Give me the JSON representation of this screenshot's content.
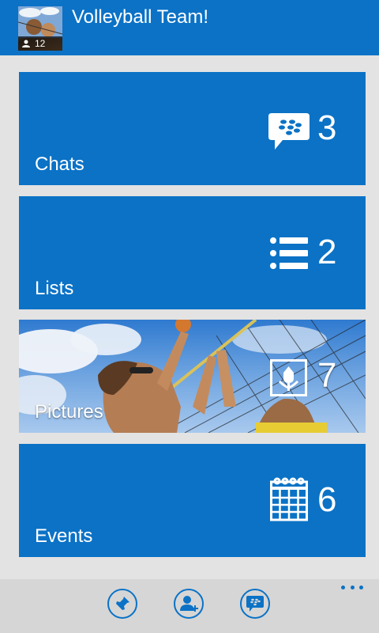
{
  "header": {
    "title": "Volleyball Team!",
    "member_count": "12"
  },
  "tiles": [
    {
      "label": "Chats",
      "count": "3",
      "icon": "bbm-chat-icon"
    },
    {
      "label": "Lists",
      "count": "2",
      "icon": "list-icon"
    },
    {
      "label": "Pictures",
      "count": "7",
      "icon": "picture-icon"
    },
    {
      "label": "Events",
      "count": "6",
      "icon": "calendar-icon"
    }
  ],
  "appbar": {
    "buttons": [
      "pin-icon",
      "add-contact-icon",
      "bbm-icon"
    ],
    "more": "more-icon"
  },
  "colors": {
    "accent": "#0b72c6",
    "background": "#e3e3e3",
    "appbar": "#d6d6d6"
  }
}
